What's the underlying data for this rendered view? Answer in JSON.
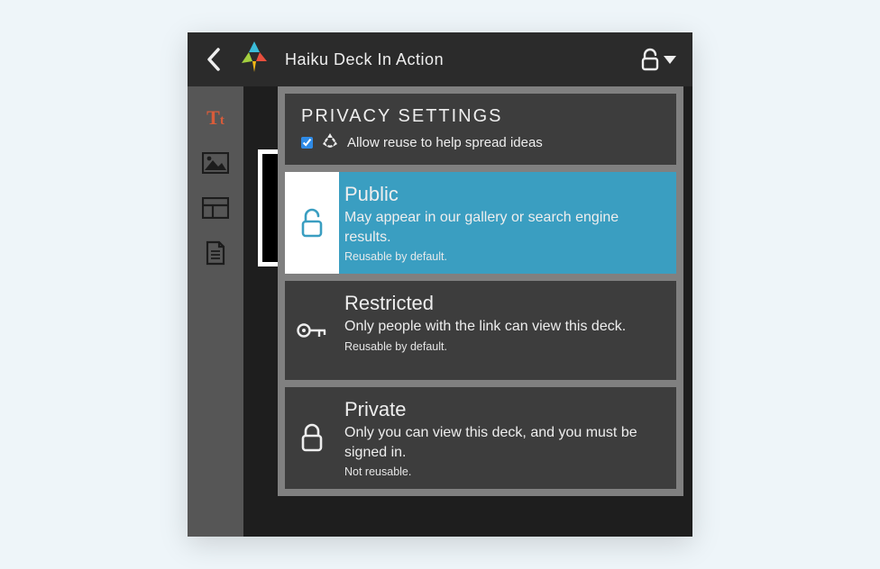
{
  "header": {
    "title": "Haiku Deck In Action"
  },
  "settings": {
    "title": "PRIVACY SETTINGS",
    "reuse_label": "Allow reuse to help spread ideas",
    "reuse_checked": true
  },
  "options": [
    {
      "key": "public",
      "title": "Public",
      "desc": "May appear in our gallery or search engine results.",
      "note": "Reusable by default.",
      "selected": true
    },
    {
      "key": "restricted",
      "title": "Restricted",
      "desc": "Only people with the link can view this deck.",
      "note": "Reusable by default.",
      "selected": false
    },
    {
      "key": "private",
      "title": "Private",
      "desc": "Only you can view this deck, and you must be signed in.",
      "note": "Not reusable.",
      "selected": false
    }
  ]
}
